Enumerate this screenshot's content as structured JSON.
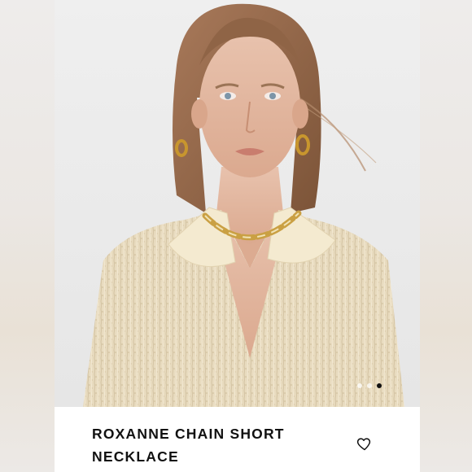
{
  "product": {
    "title": "ROXANNE CHAIN SHORT NECKLACE",
    "image_alt": "Model wearing cream ribbed knit polo sweater and gold chain short necklace"
  },
  "carousel": {
    "dot_count": 3,
    "active_index": 2
  },
  "icons": {
    "favorite": "heart-outline-icon"
  },
  "colors": {
    "accent": "#111111",
    "sweater": "#e9dcc1",
    "background": "#ececec"
  }
}
